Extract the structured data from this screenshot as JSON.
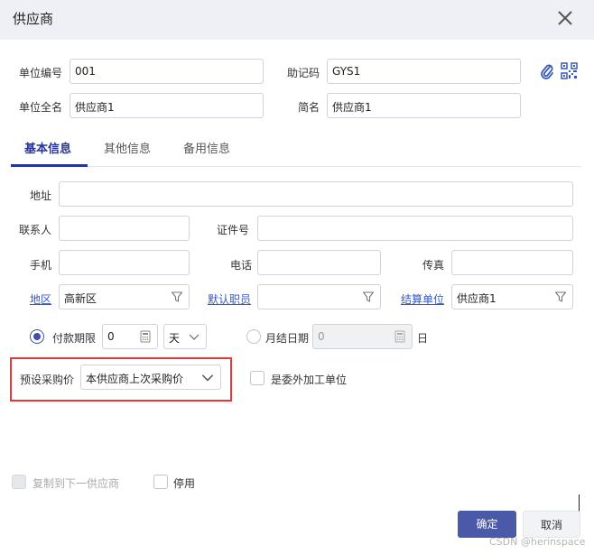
{
  "dialog": {
    "title": "供应商",
    "close_icon": "close-icon"
  },
  "header_fields": {
    "unit_code": {
      "label": "单位编号",
      "value": "001"
    },
    "memo_code": {
      "label": "助记码",
      "value": "GYS1"
    },
    "full_name": {
      "label": "单位全名",
      "value": "供应商1"
    },
    "short_name": {
      "label": "简名",
      "value": "供应商1"
    }
  },
  "header_icons": [
    "paperclip-icon",
    "qr-code-icon"
  ],
  "tabs": [
    {
      "label": "基本信息",
      "active": true
    },
    {
      "label": "其他信息",
      "active": false
    },
    {
      "label": "备用信息",
      "active": false
    }
  ],
  "basic_info": {
    "address": {
      "label": "地址",
      "value": ""
    },
    "contact": {
      "label": "联系人",
      "value": ""
    },
    "id_number": {
      "label": "证件号",
      "value": ""
    },
    "mobile": {
      "label": "手机",
      "value": ""
    },
    "phone": {
      "label": "电话",
      "value": ""
    },
    "fax": {
      "label": "传真",
      "value": ""
    },
    "region": {
      "label": "地区",
      "value": "高新区"
    },
    "default_staff": {
      "label": "默认职员",
      "value": ""
    },
    "settlement_unit": {
      "label": "结算单位",
      "value": "供应商1"
    }
  },
  "payment": {
    "term_label": "付款期限",
    "term_selected": true,
    "term_value": "0",
    "term_unit": "天",
    "monthly_label": "月结日期",
    "monthly_selected": false,
    "monthly_value": "0",
    "monthly_unit": "日"
  },
  "preset_price": {
    "label": "预设采购价",
    "value": "本供应商上次采购价"
  },
  "outsource": {
    "label": "是委外加工单位",
    "checked": false
  },
  "footer": {
    "copy_next": {
      "label": "复制到下一供应商",
      "checked": false,
      "disabled": true
    },
    "disable": {
      "label": "停用",
      "checked": false
    },
    "ok_label": "确定",
    "cancel_label": "取消"
  },
  "watermark": "CSDN @herinspace",
  "colors": {
    "accent": "#26349a",
    "primary_button": "#4b5aa8",
    "highlight": "#e0393e",
    "link": "#3a58b8"
  }
}
